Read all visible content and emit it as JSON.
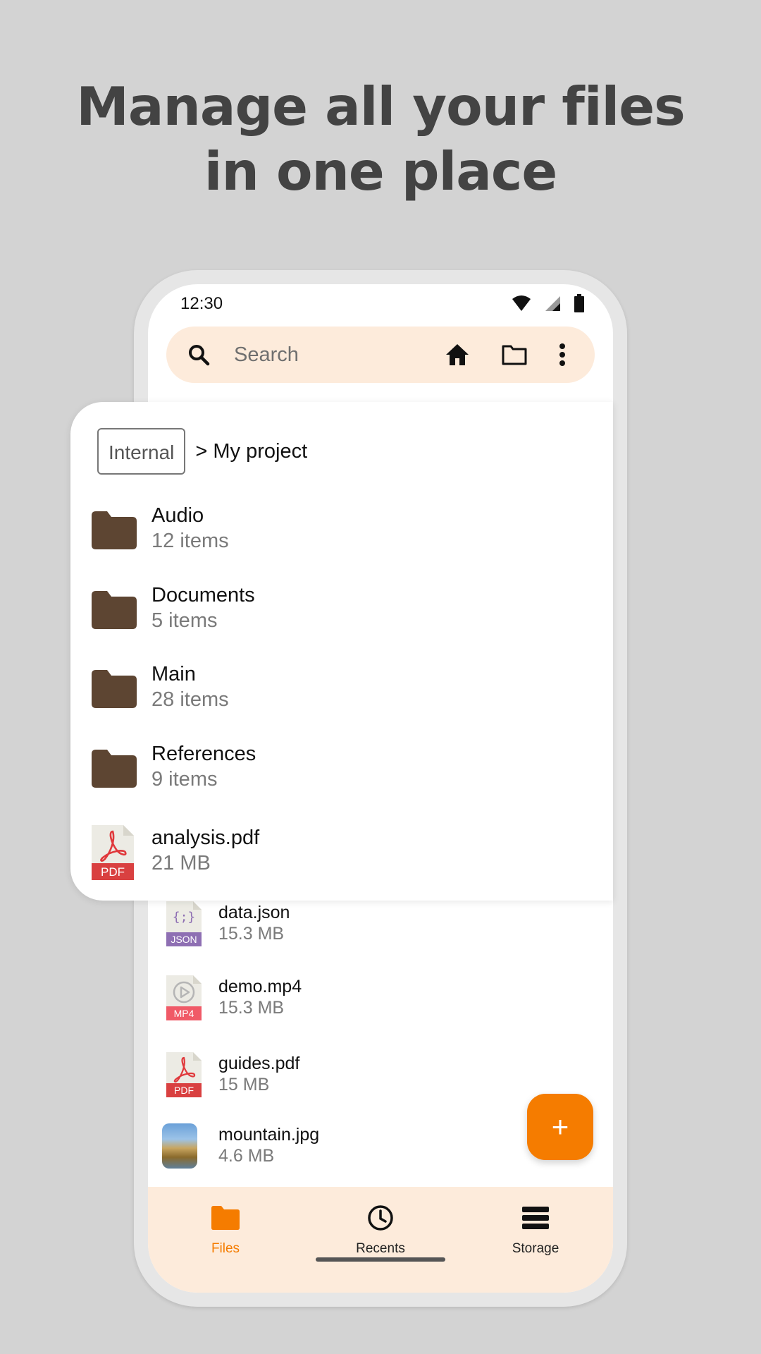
{
  "headline": {
    "line1": "Manage all your files",
    "line2": "in one place"
  },
  "status": {
    "time": "12:30"
  },
  "search": {
    "placeholder": "Search"
  },
  "breadcrumb": {
    "root": "Internal",
    "path": "> My project"
  },
  "card_items": [
    {
      "name": "Audio",
      "meta": "12 items",
      "type": "folder"
    },
    {
      "name": "Documents",
      "meta": "5 items",
      "type": "folder"
    },
    {
      "name": "Main",
      "meta": "28 items",
      "type": "folder"
    },
    {
      "name": "References",
      "meta": "9 items",
      "type": "folder"
    },
    {
      "name": "analysis.pdf",
      "meta": "21 MB",
      "type": "pdf"
    }
  ],
  "list_items": [
    {
      "name": "data.json",
      "meta": "15.3 MB",
      "type": "json",
      "badge": "JSON"
    },
    {
      "name": "demo.mp4",
      "meta": "15.3 MB",
      "type": "mp4",
      "badge": "MP4"
    },
    {
      "name": "guides.pdf",
      "meta": "15 MB",
      "type": "pdf",
      "badge": "PDF"
    },
    {
      "name": "mountain.jpg",
      "meta": "4.6 MB",
      "type": "image"
    }
  ],
  "fab": {
    "label": "+"
  },
  "nav": [
    {
      "label": "Files",
      "icon": "folder-icon",
      "active": true
    },
    {
      "label": "Recents",
      "icon": "clock-icon",
      "active": false
    },
    {
      "label": "Storage",
      "icon": "storage-icon",
      "active": false
    }
  ],
  "colors": {
    "accent": "#f57c00",
    "surface": "#fdebdb",
    "folder": "#5d4532",
    "background": "#d3d3d3"
  },
  "doc_badges": {
    "card_pdf": "PDF"
  }
}
